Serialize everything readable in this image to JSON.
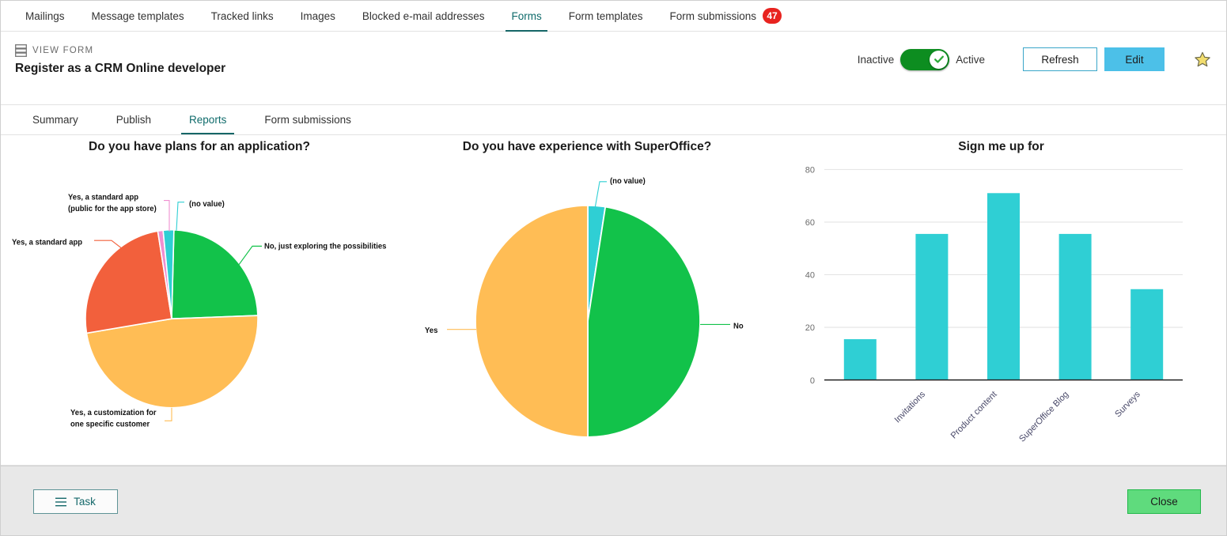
{
  "topnav": {
    "items": [
      {
        "label": "Mailings",
        "active": false
      },
      {
        "label": "Message templates",
        "active": false
      },
      {
        "label": "Tracked links",
        "active": false
      },
      {
        "label": "Images",
        "active": false
      },
      {
        "label": "Blocked e-mail addresses",
        "active": false
      },
      {
        "label": "Forms",
        "active": true
      },
      {
        "label": "Form templates",
        "active": false
      },
      {
        "label": "Form submissions",
        "active": false,
        "badge": "47"
      }
    ]
  },
  "form_header": {
    "kicker": "VIEW FORM",
    "title": "Register as a CRM Online developer",
    "icon": "form-lines-icon",
    "toggle": {
      "left_label": "Inactive",
      "right_label": "Active",
      "state": "Active",
      "on_color": "#0d8d20"
    },
    "refresh_label": "Refresh",
    "edit_label": "Edit",
    "edit_color": "#4cc0e8",
    "favorite_icon": "star-icon",
    "favorite_color": "#efd martin"
  },
  "subtabs": {
    "items": [
      {
        "label": "Summary",
        "active": false
      },
      {
        "label": "Publish",
        "active": false
      },
      {
        "label": "Reports",
        "active": true
      },
      {
        "label": "Form submissions",
        "active": false
      }
    ]
  },
  "chart_data": [
    {
      "type": "pie",
      "title": "Do you have plans for an application?",
      "labels": [
        "Yes, a customization for one specific customer",
        "Yes, a standard app",
        "Yes, a standard app (public for the app store)",
        "(no value)",
        "No, just exploring the possibilities"
      ],
      "values": [
        48,
        25,
        1,
        2,
        24
      ],
      "colors": [
        "#FFBD55",
        "#F2603C",
        "#F08FD0",
        "#2FCFD4",
        "#12C24A"
      ],
      "legend": "callout-labels",
      "grid": false
    },
    {
      "type": "pie",
      "title": "Do you have experience with SuperOffice?",
      "labels": [
        "Yes",
        "(no value)",
        "No"
      ],
      "values": [
        50,
        2.5,
        47.5
      ],
      "colors": [
        "#FFBD55",
        "#2FCFD4",
        "#12C24A"
      ],
      "legend": "callout-labels",
      "grid": false
    },
    {
      "type": "bar",
      "title": "Sign me up for",
      "categories": [
        "",
        "Invitations",
        "Product content",
        "SuperOffice Blog",
        "Surveys"
      ],
      "values": [
        15.5,
        55.5,
        71,
        55.5,
        34.5
      ],
      "xlabel": "",
      "ylabel": "",
      "ylim": [
        0,
        80
      ],
      "yticks": [
        "0",
        "20",
        "40",
        "60",
        "80"
      ],
      "bar_color": "#2FCFD4",
      "grid": true
    }
  ],
  "footer": {
    "task_label": "Task",
    "task_icon": "hamburger-icon",
    "close_label": "Close",
    "close_color": "#5fdb7d"
  }
}
